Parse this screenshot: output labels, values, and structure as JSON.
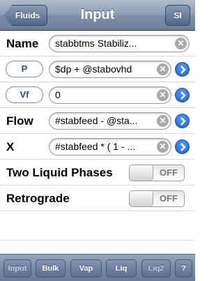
{
  "navbar": {
    "back_label": "Fluids",
    "title": "Input",
    "units_label": "SI"
  },
  "form": {
    "name": {
      "label": "Name",
      "value": "stabbtms Stabiliz..."
    },
    "p": {
      "label": "P",
      "value": "$dp + @stabovhd"
    },
    "vf": {
      "label": "Vf",
      "value": "0"
    },
    "flow": {
      "label": "Flow",
      "value": "#stabfeed - @sta..."
    },
    "x": {
      "label": "X",
      "value": "#stabfeed * ( 1 - ..."
    },
    "two_liquid": {
      "label": "Two Liquid Phases",
      "state": "OFF"
    },
    "retrograde": {
      "label": "Retrograde",
      "state": "OFF"
    }
  },
  "icons": {
    "clear": "clear-x-icon",
    "disclosure": "chevron-right-disclosure-icon"
  },
  "tabbar": {
    "tabs": [
      "Input",
      "Bulk",
      "Vap",
      "Liq",
      "Liq2",
      "?"
    ]
  }
}
